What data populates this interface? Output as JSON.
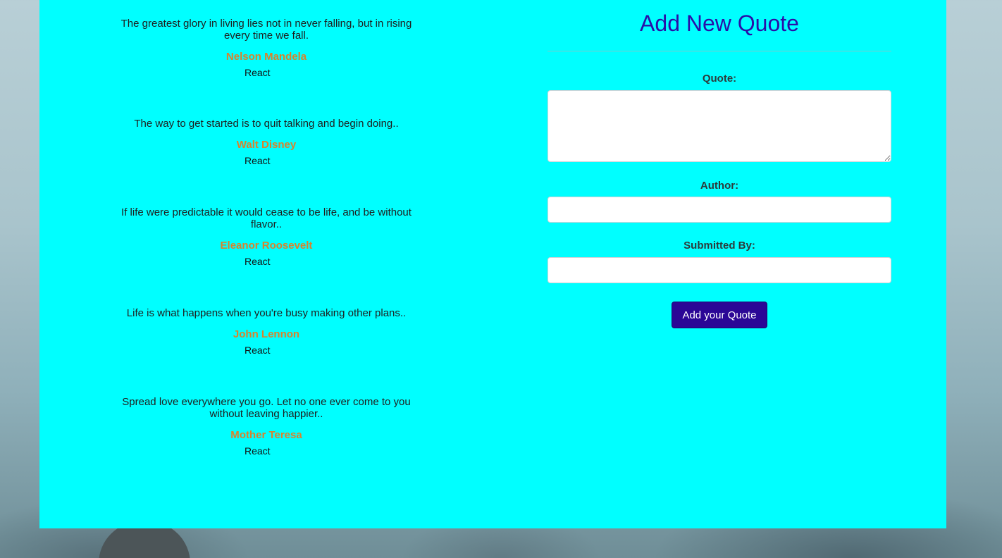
{
  "quotes": [
    {
      "text": "The greatest glory in living lies not in never falling, but in rising every time we fall.",
      "author": "Nelson Mandela",
      "react_label": "React"
    },
    {
      "text": "The way to get started is to quit talking and begin doing..",
      "author": "Walt Disney",
      "react_label": "React"
    },
    {
      "text": "If life were predictable it would cease to be life, and be without flavor..",
      "author": "Eleanor Roosevelt",
      "react_label": "React"
    },
    {
      "text": "Life is what happens when you're busy making other plans..",
      "author": "John Lennon",
      "react_label": "React"
    },
    {
      "text": "Spread love everywhere you go. Let no one ever come to you without leaving happier..",
      "author": "Mother Teresa",
      "react_label": "React"
    }
  ],
  "form": {
    "title": "Add New Quote",
    "quote_label": "Quote:",
    "quote_value": "",
    "author_label": "Author:",
    "author_value": "",
    "submitted_by_label": "Submitted By:",
    "submitted_by_value": "",
    "submit_label": "Add your Quote"
  },
  "colors": {
    "panel_background": "#00ffff",
    "title": "#2a0fa8",
    "author_accent": "#d9822b",
    "button": "#2b0796"
  }
}
